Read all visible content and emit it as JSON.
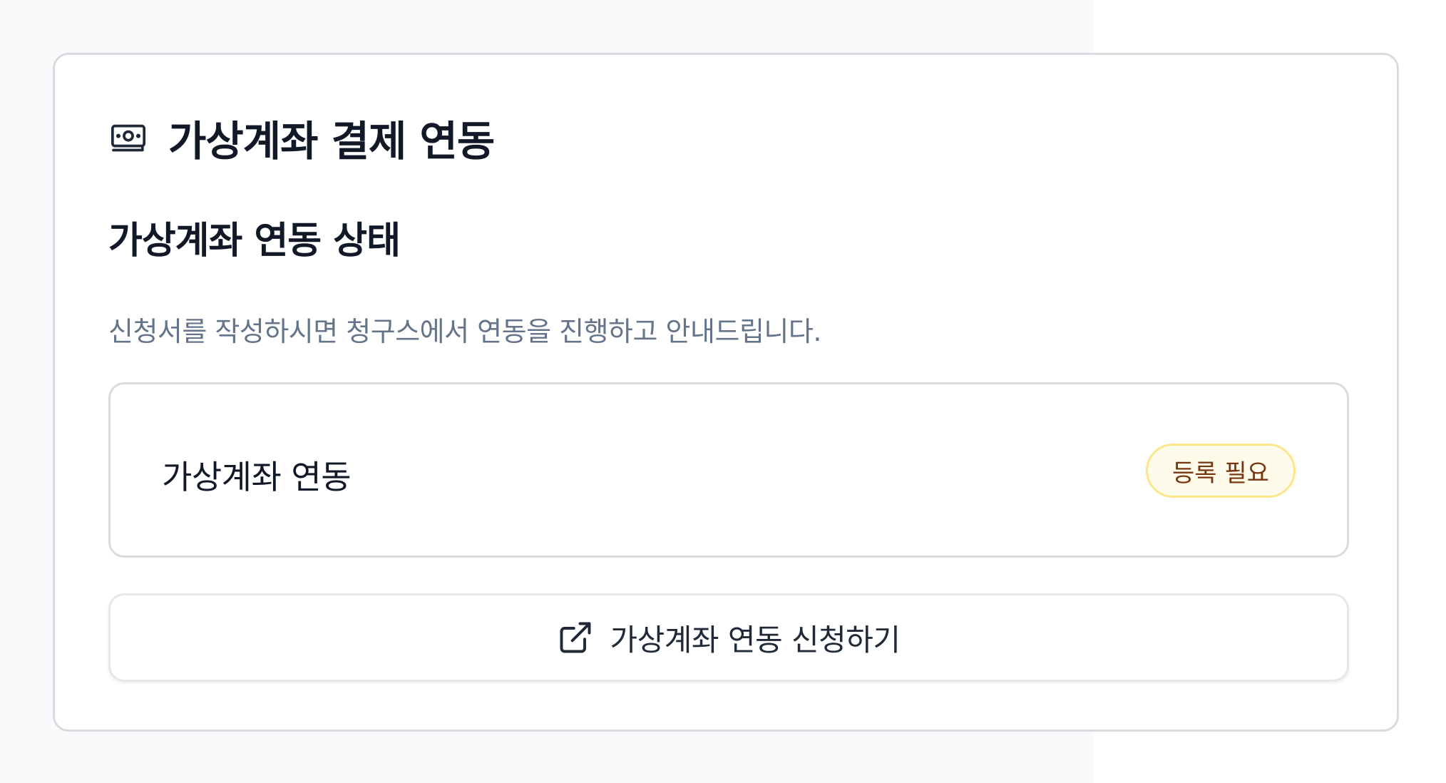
{
  "card": {
    "title": "가상계좌 결제 연동",
    "icon": "banknote-icon"
  },
  "section": {
    "title": "가상계좌 연동 상태",
    "description": "신청서를 작성하시면 청구스에서 연동을 진행하고 안내드립니다."
  },
  "status": {
    "label": "가상계좌 연동",
    "badge": "등록 필요",
    "badge_colors": {
      "background": "#fffbeb",
      "border": "#fde68a",
      "text": "#78350f"
    }
  },
  "apply_button": {
    "label": "가상계좌 연동 신청하기",
    "icon": "external-link-icon"
  },
  "colors": {
    "page_background": "#f9fafb",
    "card_border": "#d8dbe0",
    "title_text": "#111827",
    "muted_text": "#64748b"
  }
}
